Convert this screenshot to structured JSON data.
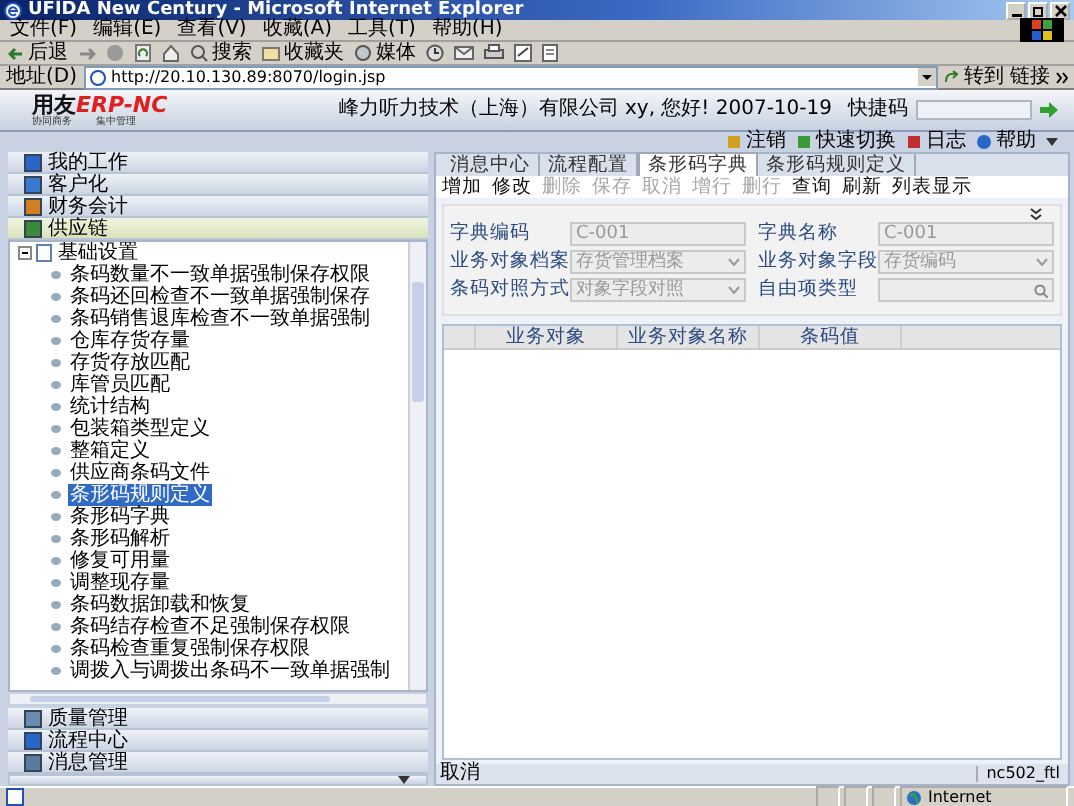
{
  "window": {
    "title": "UFIDA New Century - Microsoft Internet Explorer"
  },
  "menu": [
    "文件(F)",
    "编辑(E)",
    "查看(V)",
    "收藏(A)",
    "工具(T)",
    "帮助(H)"
  ],
  "toolbar": {
    "back": "后退",
    "search": "搜索",
    "favorites": "收藏夹",
    "media": "媒体"
  },
  "address": {
    "label": "地址(D)",
    "url": "http://20.10.130.89:8070/login.jsp",
    "go": "转到",
    "links": "链接"
  },
  "banner": {
    "brand": "用友",
    "product": "ERP-NC",
    "slogan": [
      "协同商务",
      "集中管理"
    ],
    "greeting": "峰力听力技术（上海）有限公司 xy, 您好! 2007-10-19",
    "quick_code_label": "快捷码"
  },
  "top_links": [
    {
      "label": "注销",
      "kind": "key"
    },
    {
      "label": "快速切换",
      "kind": "switch"
    },
    {
      "label": "日志",
      "kind": "log"
    },
    {
      "label": "帮助",
      "kind": "help"
    }
  ],
  "sidebar": {
    "top_groups": [
      {
        "label": "我的工作",
        "kind": "work",
        "selected": false
      },
      {
        "label": "客户化",
        "kind": "custom",
        "selected": false
      },
      {
        "label": "财务会计",
        "kind": "finance",
        "selected": false
      },
      {
        "label": "供应链",
        "kind": "supply",
        "selected": true
      }
    ],
    "tree": {
      "label": "基础设置",
      "expanded": true,
      "children": [
        {
          "label": "条码数量不一致单据强制保存权限",
          "selected": false
        },
        {
          "label": "条码还回检查不一致单据强制保存",
          "selected": false
        },
        {
          "label": "条码销售退库检查不一致单据强制",
          "selected": false
        },
        {
          "label": "仓库存货存量",
          "selected": false
        },
        {
          "label": "存货存放匹配",
          "selected": false
        },
        {
          "label": "库管员匹配",
          "selected": false
        },
        {
          "label": "统计结构",
          "selected": false
        },
        {
          "label": "包装箱类型定义",
          "selected": false
        },
        {
          "label": "整箱定义",
          "selected": false
        },
        {
          "label": "供应商条码文件",
          "selected": false
        },
        {
          "label": "条形码规则定义",
          "selected": true
        },
        {
          "label": "条形码字典",
          "selected": false
        },
        {
          "label": "条形码解析",
          "selected": false
        },
        {
          "label": "修复可用量",
          "selected": false
        },
        {
          "label": "调整现存量",
          "selected": false
        },
        {
          "label": "条码数据卸载和恢复",
          "selected": false
        },
        {
          "label": "条码结存检查不足强制保存权限",
          "selected": false
        },
        {
          "label": "条码检查重复强制保存权限",
          "selected": false
        },
        {
          "label": "调拨入与调拨出条码不一致单据强制",
          "selected": false
        }
      ]
    },
    "bottom_groups": [
      {
        "label": "质量管理",
        "kind": "quality",
        "selected": false
      },
      {
        "label": "流程中心",
        "kind": "flow",
        "selected": false
      },
      {
        "label": "消息管理",
        "kind": "message",
        "selected": false
      }
    ]
  },
  "tabs": [
    {
      "label": "消息中心",
      "selected": false
    },
    {
      "label": "流程配置",
      "selected": false
    },
    {
      "label": "条形码字典",
      "selected": true
    },
    {
      "label": "条形码规则定义",
      "selected": false
    }
  ],
  "actions": [
    {
      "label": "增加",
      "disabled": false
    },
    {
      "label": "修改",
      "disabled": false
    },
    {
      "label": "删除",
      "disabled": true
    },
    {
      "label": "保存",
      "disabled": true
    },
    {
      "label": "取消",
      "disabled": true
    },
    {
      "label": "增行",
      "disabled": true
    },
    {
      "label": "删行",
      "disabled": true
    },
    {
      "label": "查询",
      "disabled": false
    },
    {
      "label": "刷新",
      "disabled": false
    },
    {
      "label": "列表显示",
      "disabled": false
    }
  ],
  "form": {
    "fields": [
      {
        "label": "字典编码",
        "value": "C-001",
        "kind": "text"
      },
      {
        "label": "字典名称",
        "value": "C-001",
        "kind": "text"
      },
      {
        "label": "业务对象档案",
        "value": "存货管理档案",
        "kind": "select"
      },
      {
        "label": "业务对象字段",
        "value": "存货编码",
        "kind": "select"
      },
      {
        "label": "条码对照方式",
        "value": "对象字段对照",
        "kind": "select"
      },
      {
        "label": "自由项类型",
        "kind": "lookup"
      }
    ]
  },
  "table": {
    "columns": [
      "业务对象",
      "业务对象名称",
      "条码值"
    ]
  },
  "status_bar": {
    "message": "取消",
    "user": "nc502_ftl"
  },
  "ie_status": {
    "zone": "Internet"
  }
}
